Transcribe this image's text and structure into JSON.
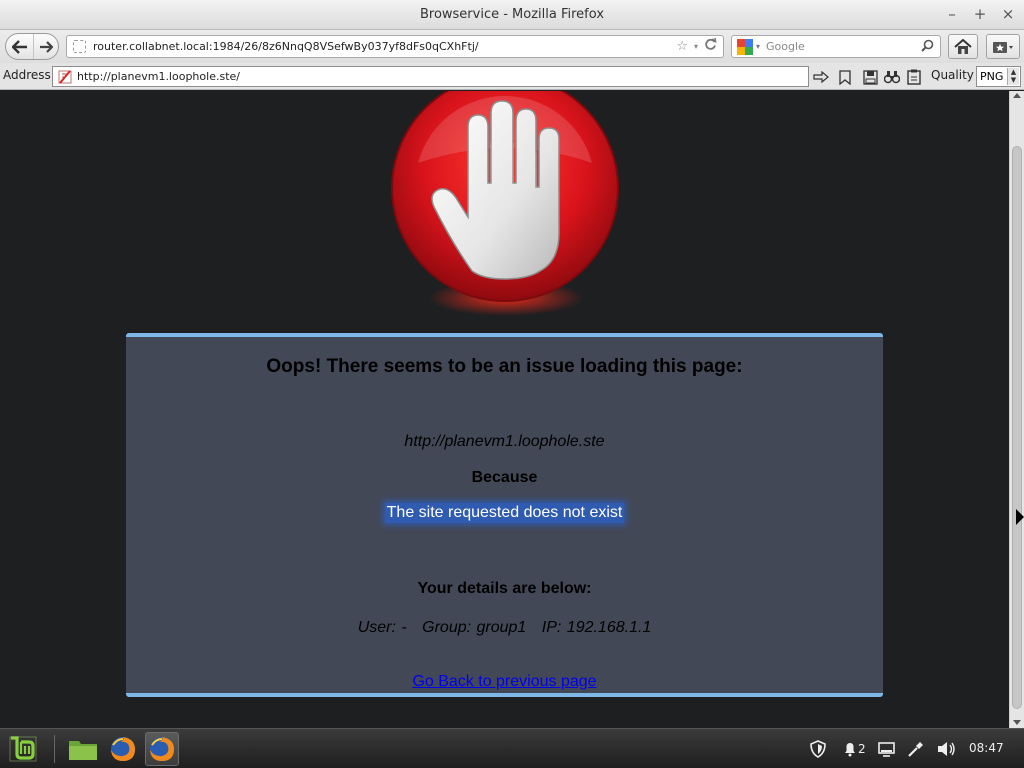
{
  "window": {
    "title": "Browservice - Mozilla Firefox",
    "controls": [
      "–",
      "+",
      "×"
    ]
  },
  "nav": {
    "url": "router.collabnet.local:1984/26/8z6NnqQ8VSefwBy037yf8dFs0qCXhFtj/",
    "search_placeholder": "Google"
  },
  "address_bar": {
    "label": "Address",
    "value": "http://planevm1.loophole.ste/",
    "quality_label": "Quality",
    "quality_value": "PNG"
  },
  "error_page": {
    "heading": "Oops! There seems to be an issue loading this page:",
    "requested_url": "http://planevm1.loophole.ste",
    "because_label": "Because",
    "reason": "The site requested does not exist",
    "details_heading": "Your details are below:",
    "user": "User: -",
    "group": "Group: group1",
    "ip": "IP: 192.168.1.1",
    "go_back_link": "Go Back to previous page"
  },
  "taskbar": {
    "notification_count": "2",
    "clock": "08:47"
  },
  "colors": {
    "panel_bg": "#434857",
    "panel_border": "#7fb7e8",
    "page_bg": "#1d1f21",
    "stop_red": "#e0141b",
    "reason_highlight": "#2f5bb0",
    "link": "#0000ee"
  }
}
